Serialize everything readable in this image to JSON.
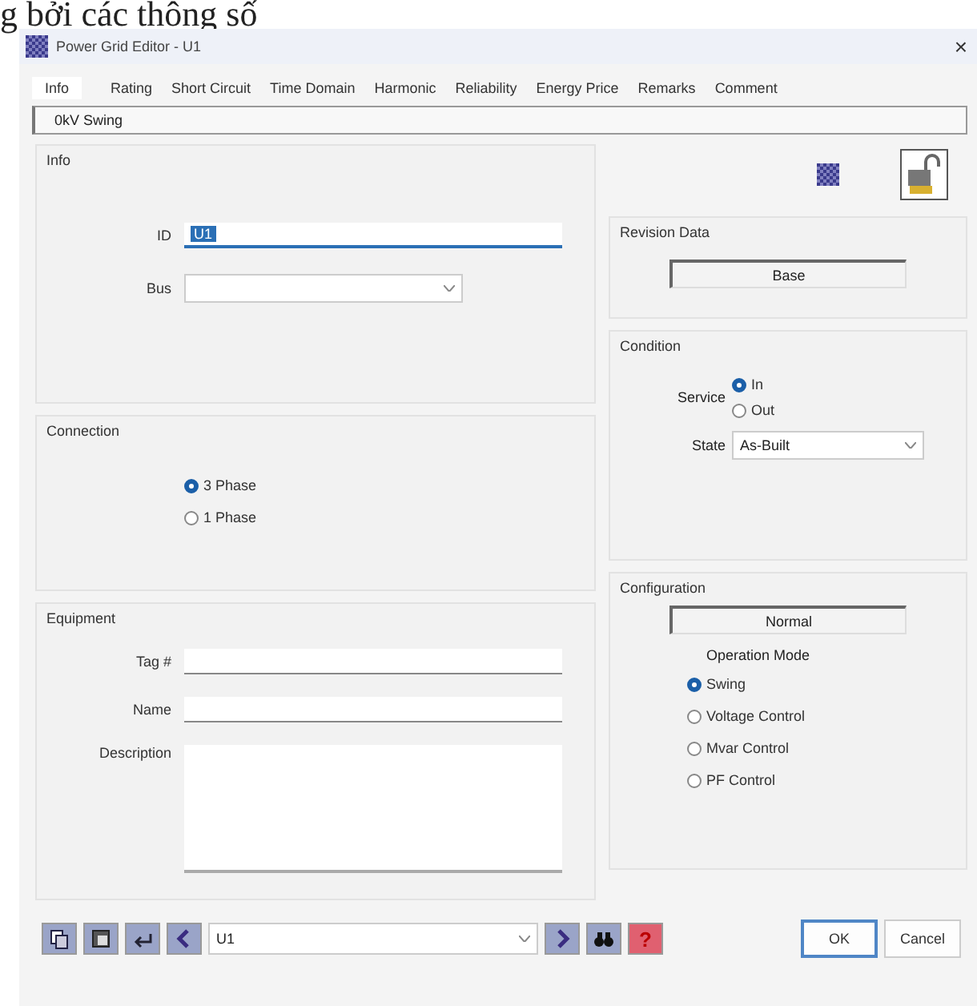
{
  "caption": "g bởi các thông số",
  "window": {
    "title": "Power Grid Editor - U1",
    "close": "×"
  },
  "tabs": [
    {
      "label": "Info",
      "selected": true
    },
    {
      "label": "Rating",
      "selected": false
    },
    {
      "label": "Short Circuit",
      "selected": false
    },
    {
      "label": "Time Domain",
      "selected": false
    },
    {
      "label": "Harmonic",
      "selected": false
    },
    {
      "label": "Reliability",
      "selected": false
    },
    {
      "label": "Energy Price",
      "selected": false
    },
    {
      "label": "Remarks",
      "selected": false
    },
    {
      "label": "Comment",
      "selected": false
    }
  ],
  "header_field": {
    "value": "0kV  Swing"
  },
  "info": {
    "title": "Info",
    "id": {
      "label": "ID",
      "value": "U1"
    },
    "bus": {
      "label": "Bus"
    }
  },
  "revision": {
    "title": "Revision Data",
    "value": "Base"
  },
  "condition": {
    "title": "Condition",
    "service": {
      "label": "Service",
      "options": [
        {
          "label": "In",
          "selected": true
        },
        {
          "label": "Out",
          "selected": false
        }
      ]
    },
    "state": {
      "label": "State",
      "value": "As-Built"
    }
  },
  "connection": {
    "title": "Connection",
    "options": [
      {
        "label": "3 Phase",
        "selected": true
      },
      {
        "label": "1 Phase",
        "selected": false
      }
    ]
  },
  "equipment": {
    "title": "Equipment",
    "fields": [
      {
        "label": "Tag #",
        "kind": "line"
      },
      {
        "label": "Name",
        "kind": "line"
      },
      {
        "label": "Description",
        "kind": "area"
      }
    ]
  },
  "configuration": {
    "title": "Configuration",
    "value": "Normal",
    "mode_label": "Operation Mode",
    "modes": [
      {
        "label": "Swing",
        "selected": true
      },
      {
        "label": "Voltage Control",
        "selected": false
      },
      {
        "label": "Mvar Control",
        "selected": false
      },
      {
        "label": "PF Control",
        "selected": false
      }
    ]
  },
  "navigator": {
    "value": "U1",
    "help": "?"
  },
  "buttons": [
    {
      "label": "OK",
      "default": true
    },
    {
      "label": "Cancel",
      "default": false
    }
  ]
}
